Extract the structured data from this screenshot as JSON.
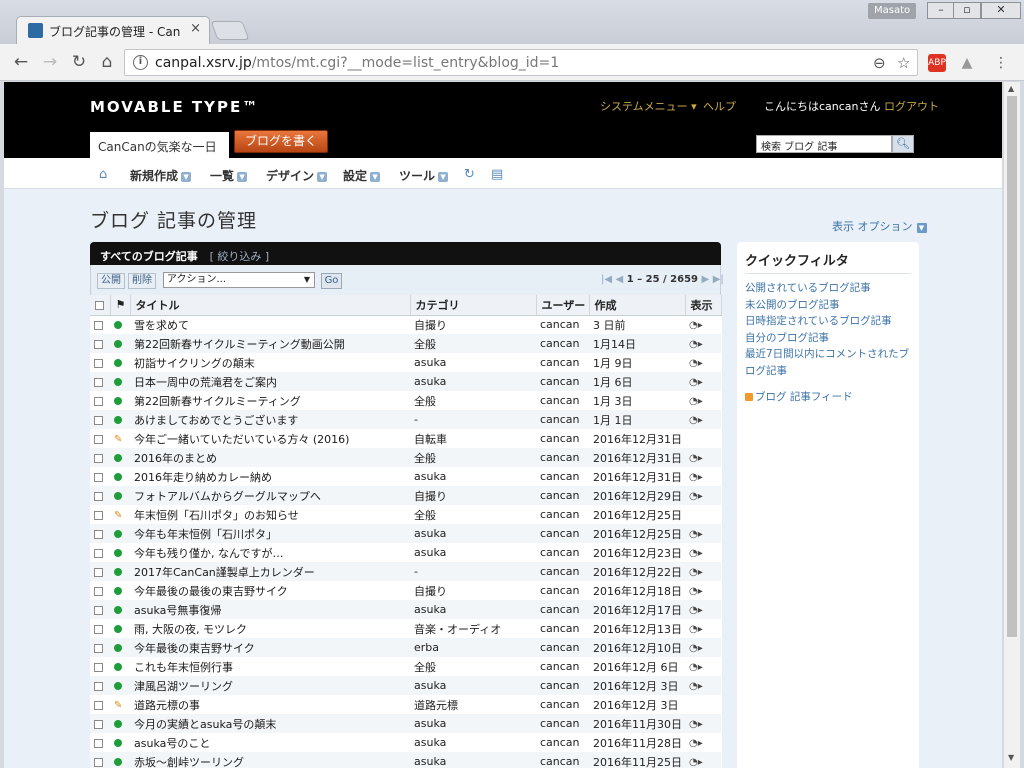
{
  "browser": {
    "tab_title": "ブログ記事の管理 - Can",
    "tab_close": "×",
    "user_badge": "Masato",
    "url_host": "canpal.xsrv.jp",
    "url_path": "/mtos/mt.cgi?__mode=list_entry&blog_id=1"
  },
  "mt": {
    "logo": "MOVABLE TYPE™",
    "system_menu": "システムメニュー ▾",
    "help": "ヘルプ",
    "greeting": "こんにちはcancanさん",
    "logout": "ログアウト",
    "blog_name": "CanCanの気楽な一日",
    "write_button": "ブログを書く",
    "search_placeholder": "検索 ブログ 記事",
    "nav": {
      "new": "新規作成",
      "list": "一覧",
      "design": "デザイン",
      "settings": "設定",
      "tools": "ツール"
    }
  },
  "main": {
    "page_title": "ブログ 記事の管理",
    "display_options": "表示 オプション",
    "list_title": "すべてのブログ記事",
    "filter_link": "[ 絞り込み ]",
    "publish_button": "公開",
    "delete_button": "削除",
    "action_select": "アクション...",
    "go_button": "Go",
    "pager": "1 – 25 / 2659",
    "columns": {
      "title": "タイトル",
      "category": "カテゴリ",
      "user": "ユーザー",
      "created": "作成",
      "view": "表示"
    },
    "rows": [
      {
        "status": "published",
        "title": "雪を求めて",
        "category": "自撮り",
        "user": "cancan",
        "date": "3 日前",
        "view": true
      },
      {
        "status": "published",
        "title": "第22回新春サイクルミーティング動画公開",
        "category": "全般",
        "user": "cancan",
        "date": "1月14日",
        "view": true
      },
      {
        "status": "published",
        "title": "初詣サイクリングの顛末",
        "category": "asuka",
        "user": "cancan",
        "date": "1月 9日",
        "view": true
      },
      {
        "status": "published",
        "title": "日本一周中の荒滝君をご案内",
        "category": "asuka",
        "user": "cancan",
        "date": "1月 6日",
        "view": true
      },
      {
        "status": "published",
        "title": "第22回新春サイクルミーティング",
        "category": "全般",
        "user": "cancan",
        "date": "1月 3日",
        "view": true
      },
      {
        "status": "published",
        "title": "あけましておめでとうございます",
        "category": "-",
        "user": "cancan",
        "date": "1月 1日",
        "view": true
      },
      {
        "status": "draft",
        "title": "今年ご一緒いていただいている方々 (2016)",
        "category": "自転車",
        "user": "cancan",
        "date": "2016年12月31日",
        "view": false
      },
      {
        "status": "published",
        "title": "2016年のまとめ",
        "category": "全般",
        "user": "cancan",
        "date": "2016年12月31日",
        "view": true
      },
      {
        "status": "published",
        "title": "2016年走り納めカレー納め",
        "category": "asuka",
        "user": "cancan",
        "date": "2016年12月31日",
        "view": true
      },
      {
        "status": "published",
        "title": "フォトアルバムからグーグルマップへ",
        "category": "自撮り",
        "user": "cancan",
        "date": "2016年12月29日",
        "view": true
      },
      {
        "status": "draft",
        "title": "年末恒例「石川ポタ」のお知らせ",
        "category": "全般",
        "user": "cancan",
        "date": "2016年12月25日",
        "view": false
      },
      {
        "status": "published",
        "title": "今年も年末恒例「石川ポタ」",
        "category": "asuka",
        "user": "cancan",
        "date": "2016年12月25日",
        "view": true
      },
      {
        "status": "published",
        "title": "今年も残り僅か, なんですが…",
        "category": "asuka",
        "user": "cancan",
        "date": "2016年12月23日",
        "view": true
      },
      {
        "status": "published",
        "title": "2017年CanCan謹製卓上カレンダー",
        "category": "-",
        "user": "cancan",
        "date": "2016年12月22日",
        "view": true
      },
      {
        "status": "published",
        "title": "今年最後の最後の東吉野サイク",
        "category": "自撮り",
        "user": "cancan",
        "date": "2016年12月18日",
        "view": true
      },
      {
        "status": "published",
        "title": "asuka号無事復帰",
        "category": "asuka",
        "user": "cancan",
        "date": "2016年12月17日",
        "view": true
      },
      {
        "status": "published",
        "title": "雨, 大阪の夜, モツレク",
        "category": "音楽・オーディオ",
        "user": "cancan",
        "date": "2016年12月13日",
        "view": true
      },
      {
        "status": "published",
        "title": "今年最後の東吉野サイク",
        "category": "erba",
        "user": "cancan",
        "date": "2016年12月10日",
        "view": true
      },
      {
        "status": "published",
        "title": "これも年末恒例行事",
        "category": "全般",
        "user": "cancan",
        "date": "2016年12月 6日",
        "view": true
      },
      {
        "status": "published",
        "title": "津風呂湖ツーリング",
        "category": "asuka",
        "user": "cancan",
        "date": "2016年12月 3日",
        "view": true
      },
      {
        "status": "draft",
        "title": "道路元標の事",
        "category": "道路元標",
        "user": "cancan",
        "date": "2016年12月 3日",
        "view": false
      },
      {
        "status": "published",
        "title": "今月の実績とasuka号の顛末",
        "category": "asuka",
        "user": "cancan",
        "date": "2016年11月30日",
        "view": true
      },
      {
        "status": "published",
        "title": "asuka号のこと",
        "category": "asuka",
        "user": "cancan",
        "date": "2016年11月28日",
        "view": true
      },
      {
        "status": "published",
        "title": "赤坂～創峠ツーリング",
        "category": "asuka",
        "user": "cancan",
        "date": "2016年11月25日",
        "view": true
      }
    ]
  },
  "quickfilter": {
    "title": "クイックフィルタ",
    "links": [
      "公開されているブログ記事",
      "未公開のブログ記事",
      "日時指定されているブログ記事",
      "自分のブログ記事",
      "最近7日間以内にコメントされたブログ記事"
    ],
    "feed": "ブログ 記事フィード"
  },
  "colors": {
    "header_bg": "#000000",
    "accent_orange": "#c0521d",
    "link_blue": "#3d73a8",
    "published_green": "#1e9e3a",
    "draft_orange": "#e08b1a"
  }
}
